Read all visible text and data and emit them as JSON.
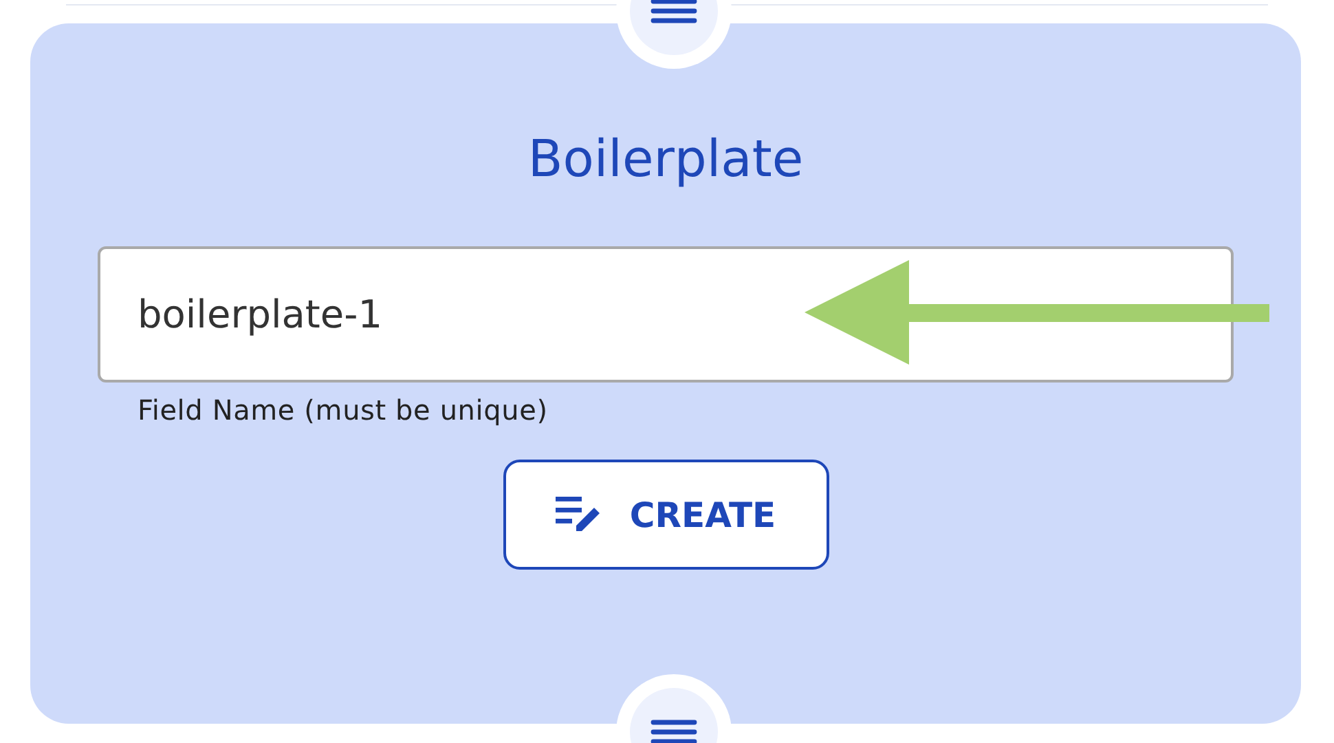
{
  "card": {
    "title": "Boilerplate",
    "field": {
      "value": "boilerplate-1",
      "helper": "Field Name (must be unique)"
    },
    "button": {
      "label": "CREATE"
    }
  }
}
